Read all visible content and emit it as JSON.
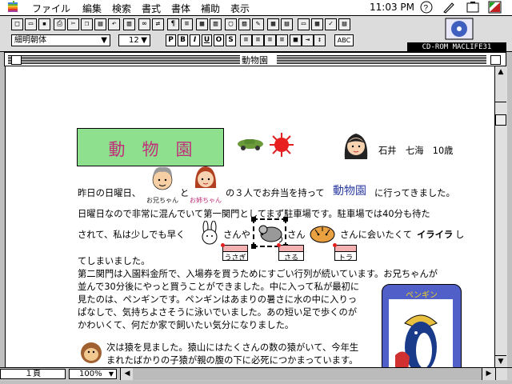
{
  "menubar": {
    "items": [
      "ファイル",
      "編集",
      "検索",
      "書式",
      "書体",
      "補助",
      "表示"
    ],
    "clock": "11:03 PM"
  },
  "toolbar": {
    "font_name": "細明朝体",
    "font_size": "12",
    "format_buttons": [
      "P",
      "B",
      "I",
      "U",
      "O",
      "S"
    ],
    "abc_label": "ABC",
    "cdrom_label": "CD-ROM MACLIFE31"
  },
  "window": {
    "title": "動物園"
  },
  "document": {
    "heading": "動　物　園",
    "author": "石井　七海　10歳",
    "lines": [
      "昨日の日曜日、",
      "と",
      "の３人でお弁当を持って",
      "動物園",
      "に行ってきました。",
      "日曜日なので非常に混んでいて第一関門としてまず駐車場です。駐車場では40分も待た",
      "されて、私は少しでも早く",
      "さんや",
      "さん",
      "さんに会いたくて",
      "イライラ",
      "し",
      "てしまいました。",
      "第二関門は入園料金所で、入場券を買うためにすごい行列が続いています。お兄ちゃんが",
      "並んで30分後にやっと買うことができました。中に入って私が最初に",
      "見たのは、ペンギンです。ペンギンはあまりの暑さに水の中に入りっ",
      "ぱなしで、気持ちよさそうに泳いでいました。あの短い足で歩くのが",
      "かわいくて、何だか家で飼いたい気分になりました。",
      "次は猿を見ました。猿山にはたくさんの数の猿がいて、今年生",
      "まれたばかりの子猿が親の腹の下に必死につかまっています。"
    ],
    "captions": [
      "お兄ちゃん",
      "お姉ちゃん"
    ],
    "animal_tags": [
      "うさぎ",
      "さる",
      "トラ"
    ],
    "card_title": "ペンギン"
  },
  "statusbar": {
    "page": "１頁",
    "zoom": "100%"
  },
  "icons": [
    "apple-icon",
    "help-icon",
    "pencil-icon",
    "application-icon",
    "car-icon",
    "sun-icon"
  ],
  "colors": {
    "heading_bg": "#8ee08e",
    "heading_text": "#c0307a",
    "link_blue": "#2a3aa0"
  }
}
